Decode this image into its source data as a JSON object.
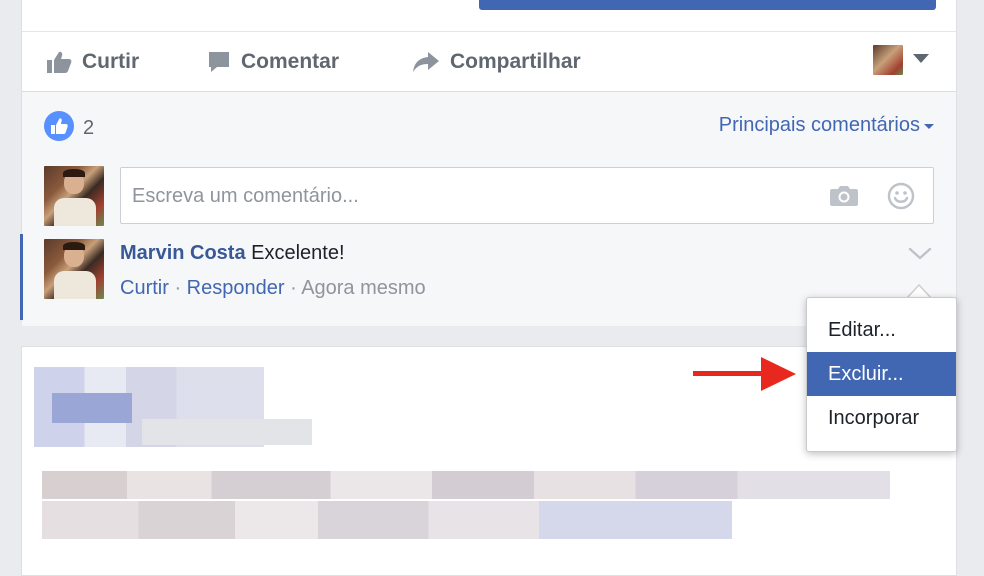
{
  "post": {
    "actions": {
      "like_label": "Curtir",
      "comment_label": "Comentar",
      "share_label": "Compartilhar"
    },
    "reactions": {
      "like_count": "2"
    },
    "sort_label": "Principais comentários",
    "composer": {
      "placeholder": "Escreva um comentário..."
    },
    "comment": {
      "author": "Marvin Costa",
      "text": " Excelente!",
      "like_link": "Curtir",
      "separator1": " · ",
      "reply_link": "Responder",
      "separator2": " · ",
      "timestamp": "Agora mesmo"
    }
  },
  "context_menu": {
    "items": [
      {
        "label": "Editar..."
      },
      {
        "label": "Excluir..."
      },
      {
        "label": "Incorporar"
      }
    ],
    "highlighted_index": 1
  },
  "colors": {
    "facebook_blue": "#4267b2",
    "author_link": "#385898",
    "annotation_arrow": "#e8281e",
    "page_bg": "#e9ebee"
  },
  "icons": [
    "thumbs-up-icon",
    "speech-bubble-icon",
    "share-arrow-icon",
    "caret-down-icon",
    "like-reaction-icon",
    "camera-icon",
    "emoji-icon",
    "chevron-down-icon",
    "red-arrow-icon"
  ]
}
